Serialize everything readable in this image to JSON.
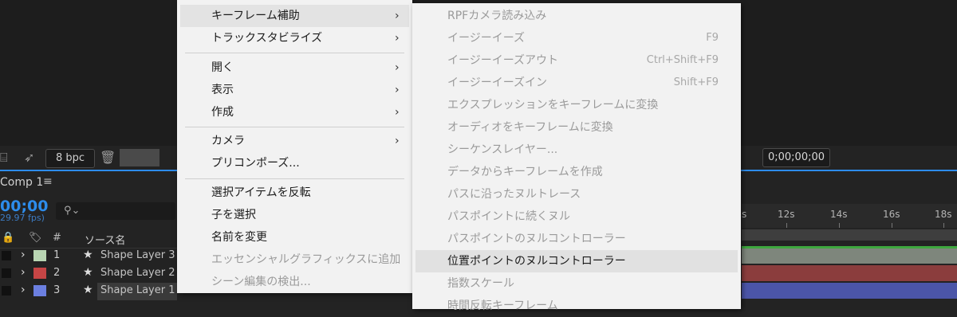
{
  "viewer_toolbar": {
    "bpc": "8 bpc",
    "timecode": "0;00;00;00"
  },
  "timeline": {
    "comp_tab": "Comp 1",
    "comp_menu": "≡",
    "current_time": "00;00",
    "fps": "29.97 fps)",
    "search_placeholder": "",
    "header": {
      "lock": "🔒",
      "label": "🏷",
      "hash": "#",
      "source_name": "ソース名"
    },
    "ruler_labels": [
      "s",
      "12s",
      "14s",
      "16s",
      "18s"
    ],
    "layers": [
      {
        "num": "1",
        "name": "Shape Layer 3",
        "color": "#b9d6b3"
      },
      {
        "num": "2",
        "name": "Shape Layer 2",
        "color": "#c64545"
      },
      {
        "num": "3",
        "name": "Shape Layer 1",
        "color": "#6b7fe0"
      }
    ],
    "track_colors": [
      "#7e867c",
      "#8b3d3d",
      "#4b55a8"
    ]
  },
  "menu1": {
    "items": [
      {
        "label": "キーフレーム補助",
        "arrow": "›",
        "highlight": true
      },
      {
        "label": "トラックスタビライズ",
        "arrow": "›"
      },
      {
        "label": "開く",
        "arrow": "›"
      },
      {
        "label": "表示",
        "arrow": "›"
      },
      {
        "label": "作成",
        "arrow": "›"
      },
      {
        "label": "カメラ",
        "arrow": "›"
      },
      {
        "label": "プリコンポーズ..."
      },
      {
        "label": "選択アイテムを反転"
      },
      {
        "label": "子を選択"
      },
      {
        "label": "名前を変更"
      },
      {
        "label": "エッセンシャルグラフィックスに追加",
        "disabled": true
      },
      {
        "label": "シーン編集の検出...",
        "disabled": true
      }
    ]
  },
  "menu2": {
    "items": [
      {
        "label": "RPFカメラ読み込み",
        "shortcut": ""
      },
      {
        "label": "イージーイーズ",
        "shortcut": "F9"
      },
      {
        "label": "イージーイーズアウト",
        "shortcut": "Ctrl+Shift+F9"
      },
      {
        "label": "イージーイーズイン",
        "shortcut": "Shift+F9"
      },
      {
        "label": "エクスプレッションをキーフレームに変換",
        "shortcut": ""
      },
      {
        "label": "オーディオをキーフレームに変換",
        "shortcut": ""
      },
      {
        "label": "シーケンスレイヤー...",
        "shortcut": ""
      },
      {
        "label": "データからキーフレームを作成",
        "shortcut": ""
      },
      {
        "label": "パスに沿ったヌルトレース",
        "shortcut": ""
      },
      {
        "label": "パスポイントに続くヌル",
        "shortcut": ""
      },
      {
        "label": "パスポイントのヌルコントローラー",
        "shortcut": ""
      },
      {
        "label": "位置ポイントのヌルコントローラー",
        "shortcut": "",
        "highlight": true
      },
      {
        "label": "指数スケール",
        "shortcut": ""
      },
      {
        "label": "時間反転キーフレーム",
        "shortcut": ""
      }
    ]
  }
}
